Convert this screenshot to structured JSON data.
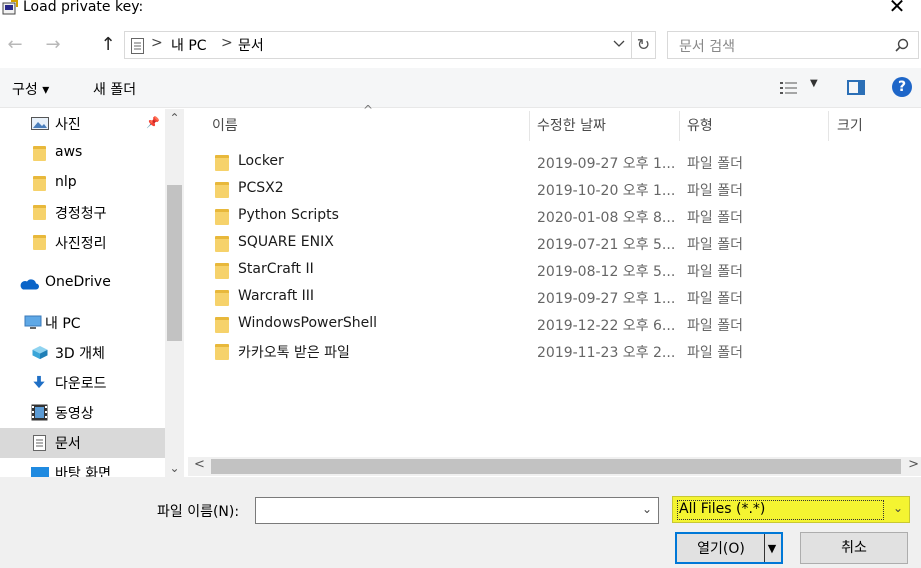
{
  "window": {
    "title": "Load private key:",
    "close_glyph": "✕"
  },
  "navigation": {
    "back_glyph": "←",
    "forward_glyph": "→",
    "up_glyph": "↑",
    "breadcrumb": [
      "내 PC",
      "문서"
    ],
    "separator": ">",
    "refresh_glyph": "↻",
    "search_placeholder": "문서 검색"
  },
  "toolbar": {
    "organize_label": "구성 ▾",
    "new_folder_label": "새 폴더",
    "help_glyph": "?"
  },
  "sidebar": {
    "items": [
      {
        "label": "사진",
        "icon": "pictures-icon",
        "pinned": true
      },
      {
        "label": "aws",
        "icon": "folder-icon"
      },
      {
        "label": "nlp",
        "icon": "folder-icon"
      },
      {
        "label": "경정청구",
        "icon": "folder-icon"
      },
      {
        "label": "사진정리",
        "icon": "folder-icon"
      },
      {
        "label": "OneDrive",
        "icon": "onedrive-icon"
      },
      {
        "label": "내 PC",
        "icon": "computer-icon"
      },
      {
        "label": "3D 개체",
        "icon": "3d-objects-icon"
      },
      {
        "label": "다운로드",
        "icon": "download-icon"
      },
      {
        "label": "동영상",
        "icon": "video-icon"
      },
      {
        "label": "문서",
        "icon": "document-icon",
        "selected": true
      },
      {
        "label": "바탕 화면",
        "icon": "desktop-icon"
      }
    ]
  },
  "file_list": {
    "columns": [
      "이름",
      "수정한 날짜",
      "유형",
      "크기"
    ],
    "rows": [
      {
        "name": "Locker",
        "modified": "2019-09-27 오후 1...",
        "type": "파일 폴더"
      },
      {
        "name": "PCSX2",
        "modified": "2019-10-20 오후 1...",
        "type": "파일 폴더"
      },
      {
        "name": "Python Scripts",
        "modified": "2020-01-08 오후 8...",
        "type": "파일 폴더"
      },
      {
        "name": "SQUARE ENIX",
        "modified": "2019-07-21 오후 5...",
        "type": "파일 폴더"
      },
      {
        "name": "StarCraft II",
        "modified": "2019-08-12 오후 5...",
        "type": "파일 폴더"
      },
      {
        "name": "Warcraft III",
        "modified": "2019-09-27 오후 1...",
        "type": "파일 폴더"
      },
      {
        "name": "WindowsPowerShell",
        "modified": "2019-12-22 오후 6...",
        "type": "파일 폴더"
      },
      {
        "name": "카카오톡 받은 파일",
        "modified": "2019-11-23 오후 2...",
        "type": "파일 폴더"
      }
    ]
  },
  "footer": {
    "filename_label": "파일 이름(N):",
    "filename_value": "",
    "filter_value": "All Files (*.*)",
    "open_label": "열기(O)",
    "cancel_label": "취소"
  },
  "colors": {
    "highlight": "#f4f431",
    "selection": "#d9d9d9",
    "accent": "#0078d7"
  }
}
